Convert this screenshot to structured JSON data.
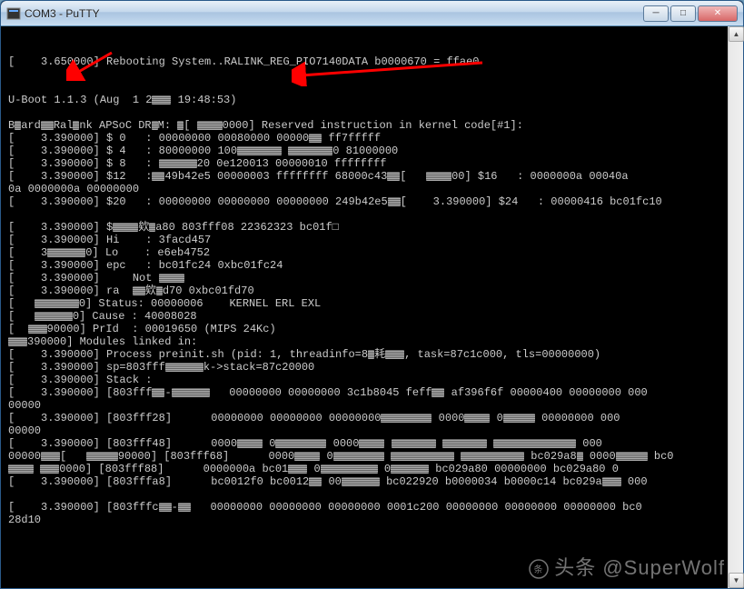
{
  "window": {
    "title": "COM3 - PuTTY"
  },
  "terminal": {
    "lines": [
      "[    3.650000] Rebooting System..RALINK_REG_PIO7140DATA b0000670 = ffae0",
      "",
      "",
      "U-Boot 1.1.3 (Aug  1 2███ 19:48:53)",
      "",
      "B█ard██Ral█nk APSoC DR█M: █[ ████0000] Reserved instruction in kernel code[#1]:",
      "[    3.390000] $ 0   : 00000000 00080000 00000██ ff7fffff",
      "[    3.390000] $ 4   : 80000000 100███████ ███████0 81000000",
      "[    3.390000] $ 8   : ██████20 0e120013 00000010 ffffffff",
      "[    3.390000] $12   :██49b42e5 00000003 ffffffff 68000c43██[   ████00] $16   : 0000000a 00040a",
      "0a 0000000a 00000000",
      "[    3.390000] $20   : 00000000 00000000 00000000 249b42e5██[    3.390000] $24   : 00000416 bc01fc10",
      "",
      "[    3.390000] $████欸█a80 803fff08 22362323 bc01f□",
      "[    3.390000] Hi    : 3facd457",
      "[    3██████0] Lo    : e6eb4752",
      "[    3.390000] epc   : bc01fc24 0xbc01fc24",
      "[    3.390000]     Not ████",
      "[    3.390000] ra  ██欸█d70 0xbc01fd70",
      "[   ███████0] Status: 00000006    KERNEL ERL EXL",
      "[   ██████0] Cause : 40008028",
      "[  ███90000] PrId  : 00019650 (MIPS 24Kc)",
      "███390000] Modules linked in:",
      "[    3.390000] Process preinit.sh (pid: 1, threadinfo=8█耗███, task=87c1c000, tls=00000000)",
      "[    3.390000] sp=803fff██████k->stack=87c20000",
      "[    3.390000] Stack :",
      "[    3.390000] [803fff██-██████   00000000 00000000 3c1b8045 feff██ af396f6f 00000400 00000000 000",
      "00000",
      "[    3.390000] [803fff28]      00000000 00000000 00000000████████ 0000████ 0█████ 00000000 000",
      "00000",
      "[    3.390000] [803fff48]      0000████ 0████████ 0000████ ███████ ███████ █████████████ 000",
      "00000███[   █████90000] [803fff68]      0000████ 0████████ ██████████ ██████████ bc029a8█ 0000█████ bc0",
      "████ ███0000] [803fff88]      0000000a bc01███ 0█████████ 0██████ bc029a80 00000000 bc029a80 0",
      "[    3.390000] [803fffa8]      bc0012f0 bc0012██ 00██████ bc022920 b0000034 b0000c14 bc029a███ 000",
      "",
      "[    3.390000] [803fffc██-██   00000000 00000000 00000000 0001c200 00000000 00000000 00000000 bc0",
      "28d10"
    ]
  },
  "watermark": {
    "text": "头条 @SuperWolf"
  },
  "arrows": {
    "color": "#ff0000"
  }
}
